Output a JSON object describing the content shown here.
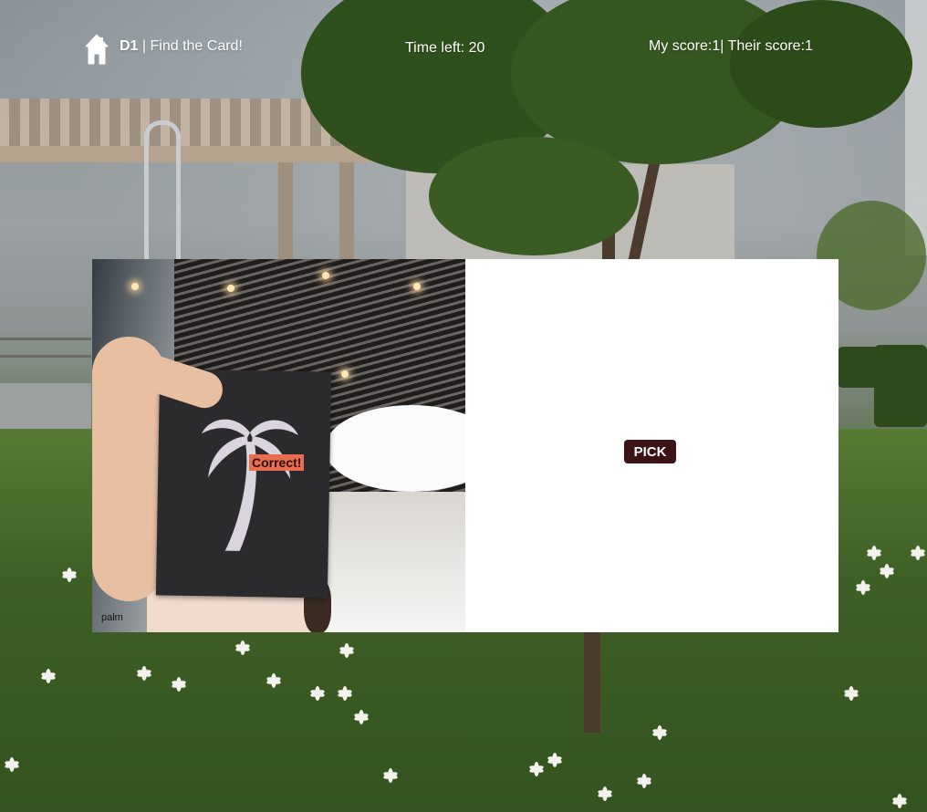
{
  "header": {
    "home_icon": "home-icon",
    "level": "D1",
    "separator": " | ",
    "title": "Find the Card!",
    "timer_text": "Time left: 20",
    "score_text": "My score:1| Their score:1"
  },
  "game": {
    "camera": {
      "result_label": "Correct!",
      "card_label": "palm",
      "card_icon": "palm-tree-icon"
    },
    "pick_button": "PICK"
  },
  "colors": {
    "pick_button_bg": "#3b1516",
    "correct_tag_bg": "#ea6c52",
    "header_text": "#ffffff"
  }
}
